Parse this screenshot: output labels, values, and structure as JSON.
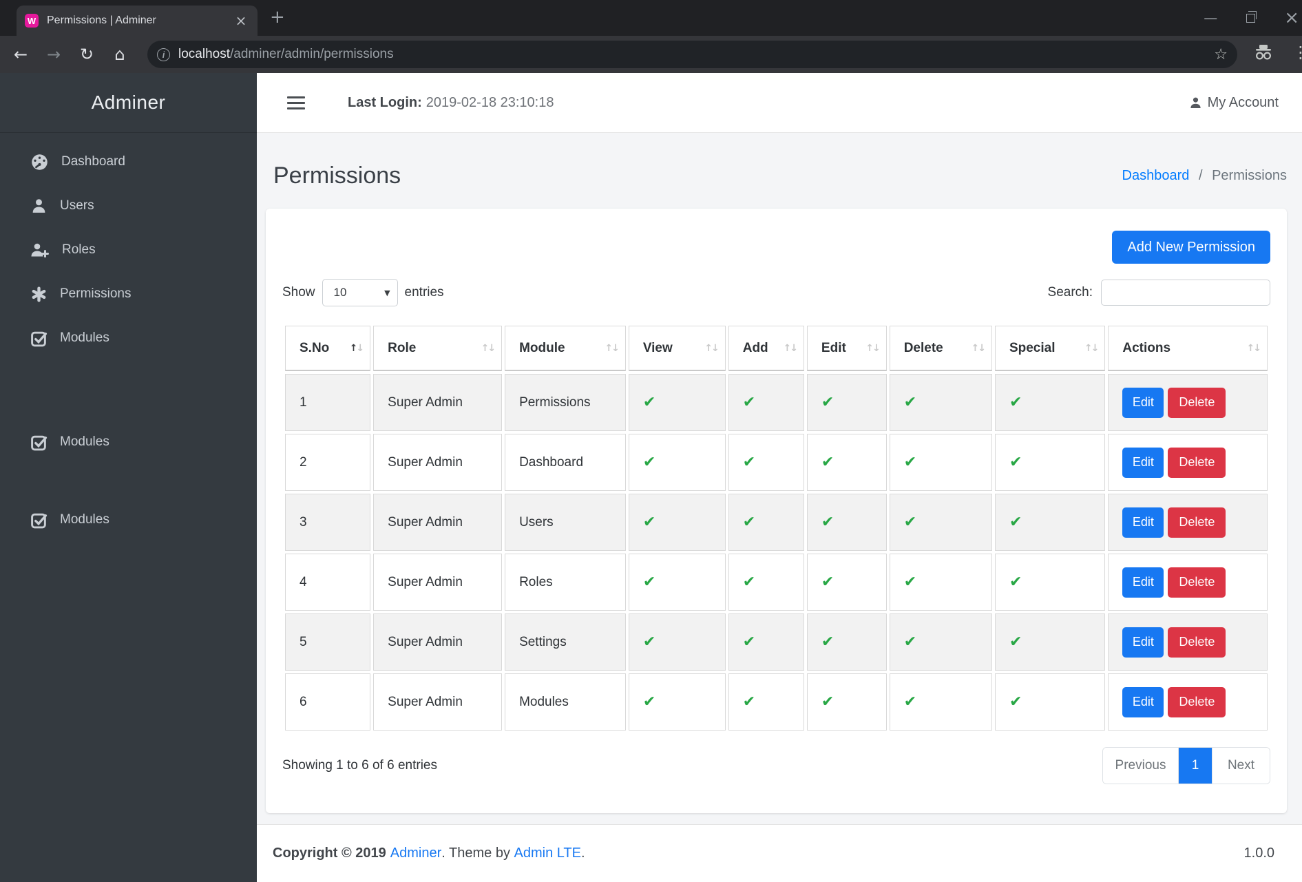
{
  "browser": {
    "tab_title": "Permissions | Adminer",
    "url_host": "localhost",
    "url_path": "/adminer/admin/permissions"
  },
  "icons": {
    "favicon_glyph": "W",
    "back": "←",
    "forward": "→",
    "reload": "↻",
    "home": "⌂",
    "info": "i",
    "star": "☆",
    "new_tab": "+",
    "tab_close": "×",
    "menu_dots": "⋮",
    "minimize": "—",
    "window_close": "×",
    "check": "✔",
    "sort_up": "↑",
    "sort_down": "↓",
    "dropdown_arrow": "▼",
    "breadcrumb_sep": "/"
  },
  "sidebar": {
    "brand": "Adminer",
    "items": [
      {
        "label": "Dashboard",
        "icon": "dashboard-icon"
      },
      {
        "label": "Users",
        "icon": "user-icon"
      },
      {
        "label": "Roles",
        "icon": "user-plus-icon"
      },
      {
        "label": "Permissions",
        "icon": "asterisk-icon"
      },
      {
        "label": "Modules",
        "icon": "check-square-icon"
      },
      {
        "label": "Modules",
        "icon": "check-square-icon"
      },
      {
        "label": "Modules",
        "icon": "check-square-icon"
      }
    ]
  },
  "header": {
    "last_login_label": "Last Login:",
    "last_login_value": "2019-02-18 23:10:18",
    "my_account": "My Account"
  },
  "page": {
    "title": "Permissions",
    "breadcrumb": {
      "link": "Dashboard",
      "current": "Permissions"
    }
  },
  "card": {
    "add_button": "Add New Permission",
    "show_label": "Show",
    "show_value": "10",
    "entries_label": "entries",
    "search_label": "Search:",
    "search_value": ""
  },
  "table": {
    "columns": [
      "S.No",
      "Role",
      "Module",
      "View",
      "Add",
      "Edit",
      "Delete",
      "Special",
      "Actions"
    ],
    "rows": [
      {
        "sno": "1",
        "role": "Super Admin",
        "module": "Permissions",
        "view": true,
        "add": true,
        "edit": true,
        "delete": true,
        "special": true
      },
      {
        "sno": "2",
        "role": "Super Admin",
        "module": "Dashboard",
        "view": true,
        "add": true,
        "edit": true,
        "delete": true,
        "special": true
      },
      {
        "sno": "3",
        "role": "Super Admin",
        "module": "Users",
        "view": true,
        "add": true,
        "edit": true,
        "delete": true,
        "special": true
      },
      {
        "sno": "4",
        "role": "Super Admin",
        "module": "Roles",
        "view": true,
        "add": true,
        "edit": true,
        "delete": true,
        "special": true
      },
      {
        "sno": "5",
        "role": "Super Admin",
        "module": "Settings",
        "view": true,
        "add": true,
        "edit": true,
        "delete": true,
        "special": true
      },
      {
        "sno": "6",
        "role": "Super Admin",
        "module": "Modules",
        "view": true,
        "add": true,
        "edit": true,
        "delete": true,
        "special": true
      }
    ],
    "row_actions": {
      "edit": "Edit",
      "delete": "Delete"
    }
  },
  "pagination": {
    "showing": "Showing 1 to 6 of 6 entries",
    "previous": "Previous",
    "page": "1",
    "next": "Next"
  },
  "footer": {
    "copyright": "Copyright © 2019",
    "brand": "Adminer",
    "middle": ". Theme by",
    "theme": "Admin LTE",
    "end": ".",
    "version": "1.0.0"
  },
  "colors": {
    "primary_blue": "#1778f2",
    "link_blue": "#007bff",
    "danger_red": "#dc3545",
    "success_green": "#28a745",
    "sidebar_bg": "#343a40",
    "chrome_dark": "#202124",
    "favicon_pink": "#e5199c"
  }
}
